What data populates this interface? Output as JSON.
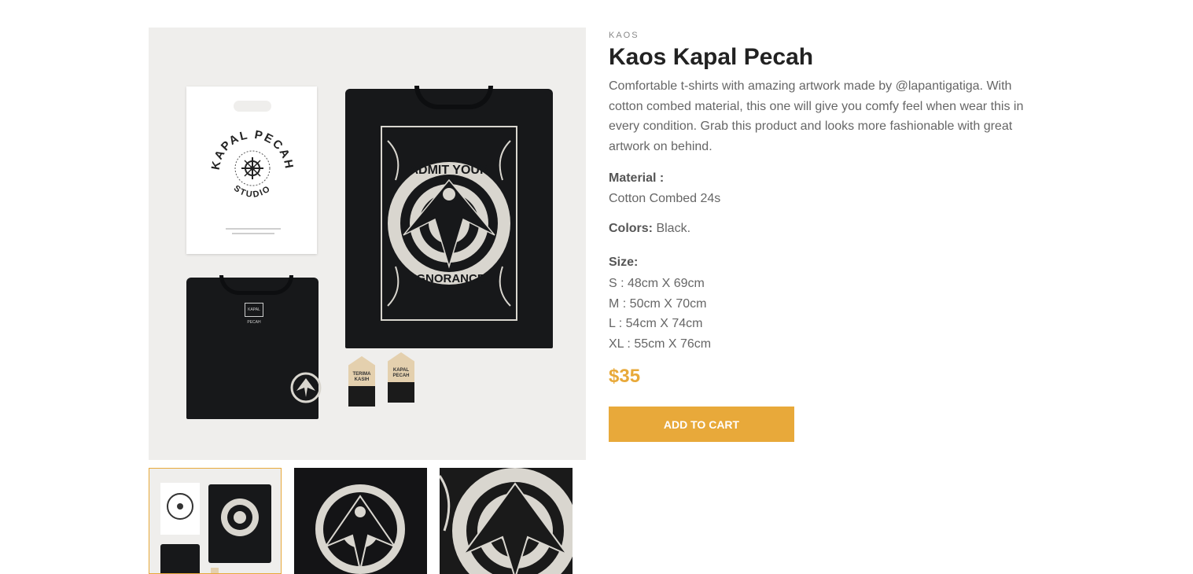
{
  "gallery": {
    "bag_text": "KAPAL PECAH",
    "bag_subtext": "STUDIO",
    "shirt_art_top": "ADMIT YOUR",
    "shirt_art_bottom": "IGNORANCE",
    "label_text": "KAPAL PECAH",
    "tag1_text": "TERIMA KASIH",
    "tag2_text": "KAPAL PECAH",
    "thumbnails": [
      {
        "name": "thumbnail-flatlay",
        "selected": true
      },
      {
        "name": "thumbnail-emblem",
        "selected": false
      },
      {
        "name": "thumbnail-artwork",
        "selected": false
      }
    ]
  },
  "product": {
    "category": "KAOS",
    "title": "Kaos Kapal Pecah",
    "description": "Comfortable t-shirts with amazing artwork made by @lapantigatiga. With cotton combed material, this one will give you comfy feel when wear this in every condition. Grab this product and looks more fashionable with great artwork on behind.",
    "material_label": "Material :",
    "material_value": "Cotton Combed 24s",
    "colors_label": "Colors:",
    "colors_value": " Black.",
    "size_label": "Size:",
    "sizes": [
      "S : 48cm X 69cm",
      "M : 50cm X 70cm",
      "L : 54cm X 74cm",
      "XL : 55cm X 76cm"
    ],
    "price": "$35",
    "add_to_cart": "ADD TO CART"
  },
  "colors": {
    "accent": "#e8a93a",
    "shirt": "#17181a",
    "background": "#efeeec"
  }
}
